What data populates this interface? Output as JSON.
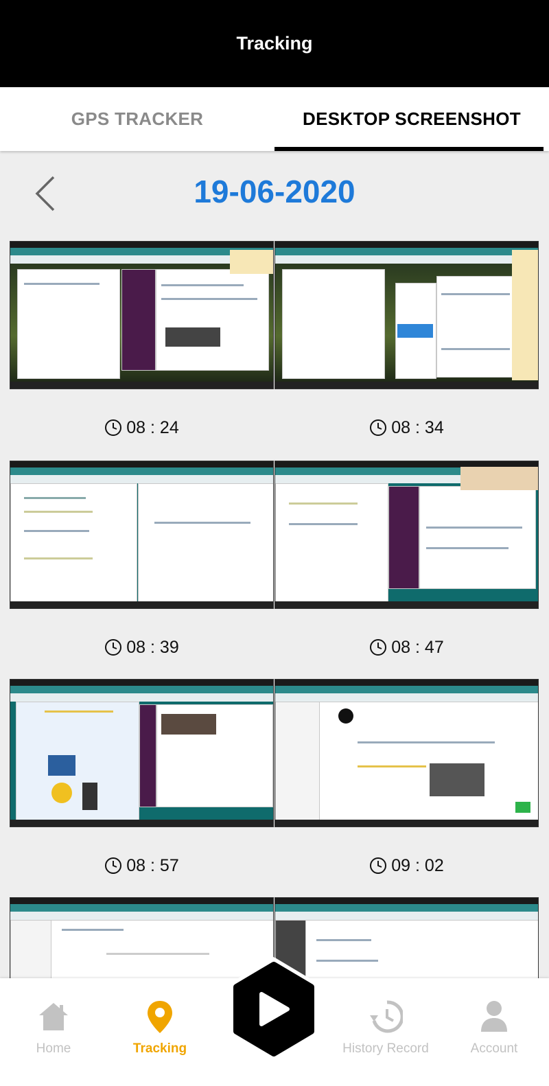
{
  "header": {
    "title": "Tracking"
  },
  "tabs": [
    {
      "label": "GPS TRACKER",
      "active": false
    },
    {
      "label": "DESKTOP SCREENSHOT",
      "active": true
    }
  ],
  "date_nav": {
    "date": "19-06-2020",
    "back_icon": "chevron-left-icon"
  },
  "screenshots": [
    {
      "time": "08 : 24"
    },
    {
      "time": "08 : 34"
    },
    {
      "time": "08 : 39"
    },
    {
      "time": "08 : 47"
    },
    {
      "time": "08 : 57"
    },
    {
      "time": "09 : 02"
    },
    {
      "time": ""
    },
    {
      "time": ""
    }
  ],
  "bottom_nav": {
    "items": [
      {
        "label": "Home",
        "icon": "home-icon"
      },
      {
        "label": "Tracking",
        "icon": "location-pin-icon",
        "active": true
      },
      {
        "label": "History Record",
        "icon": "history-icon"
      },
      {
        "label": "Account",
        "icon": "person-icon"
      }
    ],
    "play_icon": "play-icon"
  },
  "colors": {
    "header_bg": "#000000",
    "date_text": "#1e7ad9",
    "active_nav": "#f0a500",
    "inactive_nav": "#c2c2c2"
  }
}
